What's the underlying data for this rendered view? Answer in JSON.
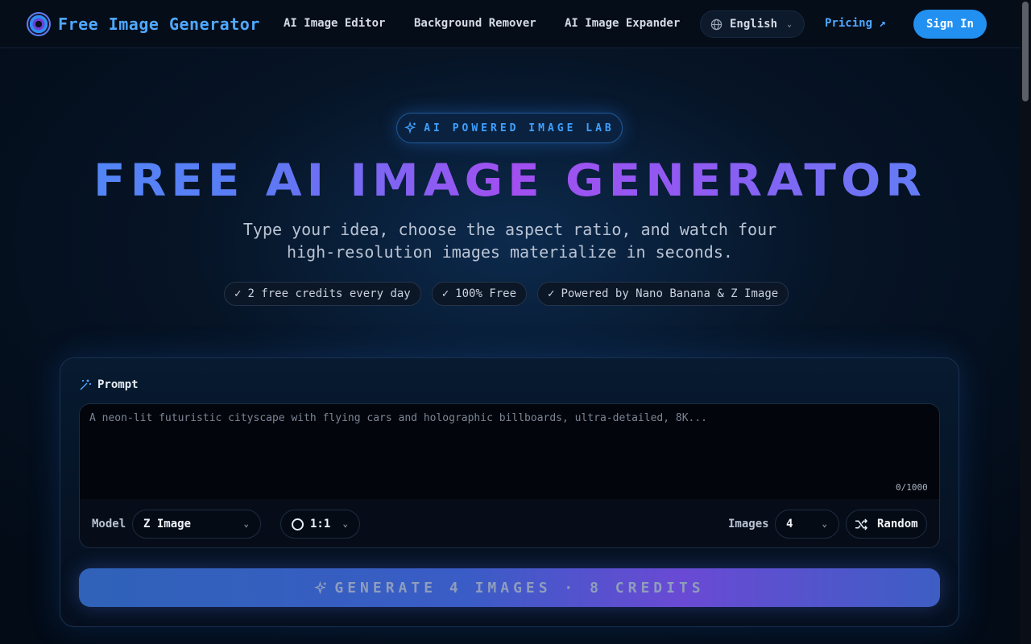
{
  "nav": {
    "brand": "Free Image Generator",
    "links": [
      "AI Image Editor",
      "Background Remover",
      "AI Image Expander"
    ],
    "language": "English",
    "pricing": "Pricing ↗",
    "sign_in": "Sign In"
  },
  "hero": {
    "badge": "AI POWERED IMAGE LAB",
    "title": "FREE AI IMAGE GENERATOR",
    "subtitle_line1": "Type your idea, choose the aspect ratio, and watch four",
    "subtitle_line2": "high-resolution images materialize in seconds.",
    "features": [
      "2 free credits every day",
      "100% Free",
      "Powered by Nano Banana & Z Image"
    ]
  },
  "form": {
    "prompt_label": "Prompt",
    "prompt_placeholder": "A neon-lit futuristic cityscape with flying cars and holographic billboards, ultra-detailed, 8K...",
    "prompt_value": "",
    "counter": "0/1000",
    "model_label": "Model",
    "model_value": "Z Image",
    "ratio_value": "1:1",
    "images_label": "Images",
    "images_value": "4",
    "random_label": "Random",
    "generate_label": "GENERATE 4 IMAGES · 8 CREDITS"
  },
  "colors": {
    "accent": "#2290f0",
    "brand_text": "#4fa8ff",
    "title_gradient_start": "#4f8cf7",
    "title_gradient_mid": "#a24ff0"
  },
  "icons": {
    "brand": "brand-logo-icon",
    "language": "globe-icon",
    "badge": "sparkle-icon",
    "prompt": "magic-wand-icon",
    "ratio": "circle-icon",
    "random": "shuffle-icon",
    "generate": "sparkle-icon"
  }
}
